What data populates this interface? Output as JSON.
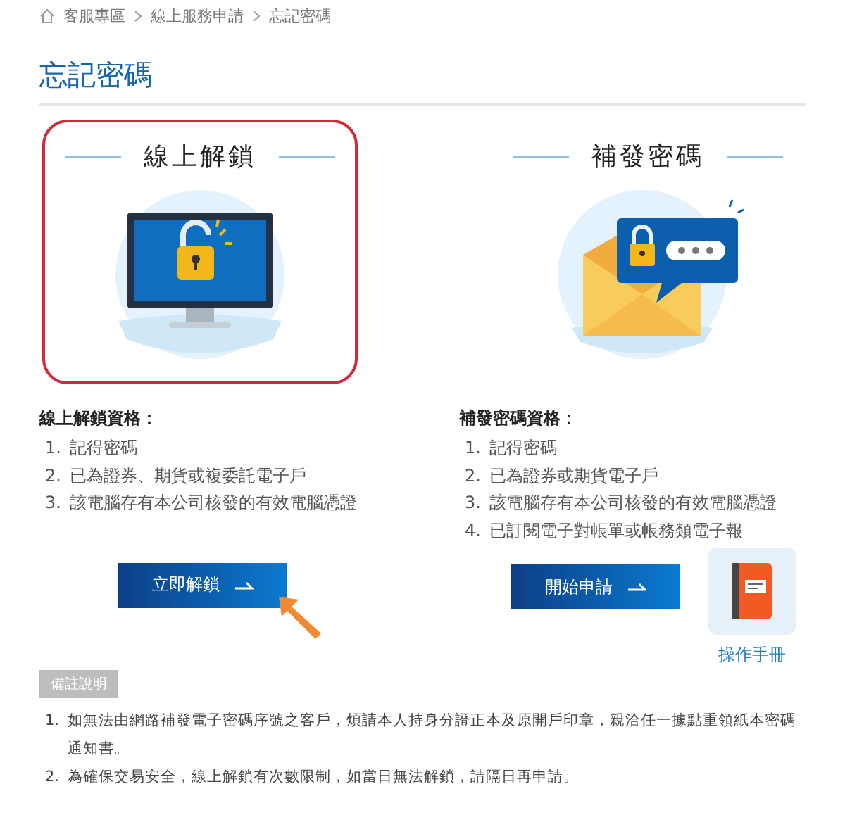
{
  "breadcrumb": [
    "客服專區",
    "線上服務申請",
    "忘記密碼"
  ],
  "title": "忘記密碼",
  "options": [
    {
      "kind": "unlock",
      "heading": "線上解鎖",
      "highlighted": true,
      "qualification_title": "線上解鎖資格：",
      "qualifications": [
        {
          "number": "1.",
          "text": "記得密碼"
        },
        {
          "number": "2.",
          "text": "已為證券、期貨或複委託電子戶"
        },
        {
          "number": "3.",
          "text": "該電腦存有本公司核發的有效電腦憑證"
        }
      ],
      "button": "立即解鎖",
      "pointer_arrow": true
    },
    {
      "kind": "reissue",
      "heading": "補發密碼",
      "highlighted": false,
      "qualification_title": "補發密碼資格：",
      "qualifications": [
        {
          "number": "1.",
          "text": "記得密碼"
        },
        {
          "number": "2.",
          "text": "已為證券或期貨電子戶"
        },
        {
          "number": "3.",
          "text": "該電腦存有本公司核發的有效電腦憑證"
        },
        {
          "number": "4.",
          "text": "已訂閱電子對帳單或帳務類電子報"
        }
      ],
      "button": "開始申請"
    }
  ],
  "manual": {
    "label": "操作手冊"
  },
  "notes": {
    "badge": "備註說明",
    "items": [
      {
        "number": "1.",
        "text": "如無法由網路補發電子密碼序號之客戶，煩請本人持身分證正本及原開戶印章，親洽任一據點重領紙本密碼通知書。"
      },
      {
        "number": "2.",
        "text": "為確保交易安全，線上解鎖有次數限制，如當日無法解鎖，請隔日再申請。"
      }
    ]
  }
}
